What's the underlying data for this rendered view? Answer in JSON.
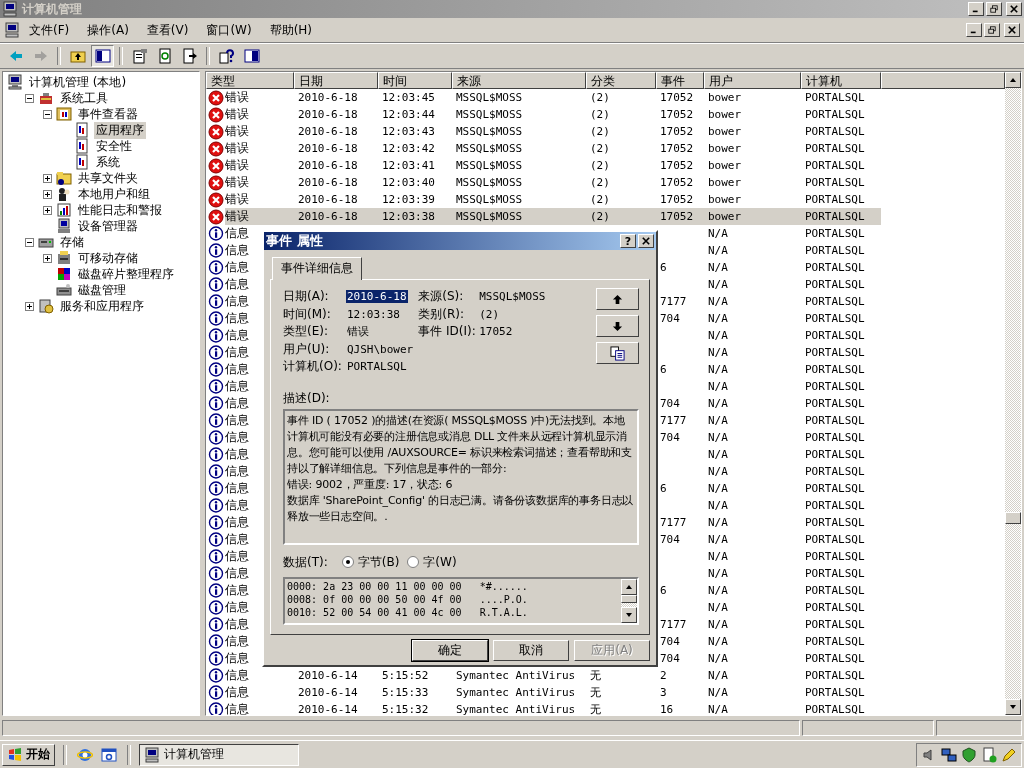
{
  "window": {
    "title": "计算机管理"
  },
  "menu": [
    "文件(F)",
    "操作(A)",
    "查看(V)",
    "窗口(W)",
    "帮助(H)"
  ],
  "toolbar": [
    {
      "disabled": false,
      "pressed": false
    },
    {
      "disabled": true,
      "pressed": false
    },
    {
      "disabled": false,
      "pressed": false
    },
    {
      "disabled": false,
      "pressed": true
    },
    {
      "disabled": false,
      "pressed": false
    },
    {
      "disabled": false,
      "pressed": false
    },
    {
      "disabled": false,
      "pressed": false
    },
    {
      "disabled": false,
      "pressed": false
    },
    {
      "disabled": false,
      "pressed": false
    }
  ],
  "tree": [
    {
      "label": "计算机管理 (本地)",
      "selected": false,
      "children": [
        {
          "label": "系统工具",
          "selected": false,
          "expanded": true,
          "children": [
            {
              "label": "事件查看器",
              "selected": false,
              "expanded": true,
              "children": [
                {
                  "label": "应用程序",
                  "selected": true
                },
                {
                  "label": "安全性",
                  "selected": false
                },
                {
                  "label": "系统",
                  "selected": false
                }
              ]
            },
            {
              "label": "共享文件夹",
              "selected": false,
              "expanded": false
            },
            {
              "label": "本地用户和组",
              "selected": false,
              "expanded": false
            },
            {
              "label": "性能日志和警报",
              "selected": false,
              "expanded": false
            },
            {
              "label": "设备管理器",
              "selected": false
            }
          ]
        },
        {
          "label": "存储",
          "selected": false,
          "expanded": true,
          "children": [
            {
              "label": "可移动存储",
              "selected": false,
              "expanded": false
            },
            {
              "label": "磁盘碎片整理程序",
              "selected": false
            },
            {
              "label": "磁盘管理",
              "selected": false
            }
          ]
        },
        {
          "label": "服务和应用程序",
          "selected": false,
          "expanded": false
        }
      ]
    }
  ],
  "table": {
    "columns": [
      "类型",
      "日期",
      "时间",
      "来源",
      "分类",
      "事件",
      "用户",
      "计算机"
    ],
    "rows": [
      {
        "kind": "error",
        "type": "错误",
        "date": "2010-6-18",
        "time": "12:03:45",
        "source": "MSSQL$MOSS",
        "category": "(2)",
        "event": "17052",
        "user": "bower",
        "computer": "PORTALSQL",
        "selected": false
      },
      {
        "kind": "error",
        "type": "错误",
        "date": "2010-6-18",
        "time": "12:03:44",
        "source": "MSSQL$MOSS",
        "category": "(2)",
        "event": "17052",
        "user": "bower",
        "computer": "PORTALSQL",
        "selected": false
      },
      {
        "kind": "error",
        "type": "错误",
        "date": "2010-6-18",
        "time": "12:03:43",
        "source": "MSSQL$MOSS",
        "category": "(2)",
        "event": "17052",
        "user": "bower",
        "computer": "PORTALSQL",
        "selected": false
      },
      {
        "kind": "error",
        "type": "错误",
        "date": "2010-6-18",
        "time": "12:03:42",
        "source": "MSSQL$MOSS",
        "category": "(2)",
        "event": "17052",
        "user": "bower",
        "computer": "PORTALSQL",
        "selected": false
      },
      {
        "kind": "error",
        "type": "错误",
        "date": "2010-6-18",
        "time": "12:03:41",
        "source": "MSSQL$MOSS",
        "category": "(2)",
        "event": "17052",
        "user": "bower",
        "computer": "PORTALSQL",
        "selected": false
      },
      {
        "kind": "error",
        "type": "错误",
        "date": "2010-6-18",
        "time": "12:03:40",
        "source": "MSSQL$MOSS",
        "category": "(2)",
        "event": "17052",
        "user": "bower",
        "computer": "PORTALSQL",
        "selected": false
      },
      {
        "kind": "error",
        "type": "错误",
        "date": "2010-6-18",
        "time": "12:03:39",
        "source": "MSSQL$MOSS",
        "category": "(2)",
        "event": "17052",
        "user": "bower",
        "computer": "PORTALSQL",
        "selected": false
      },
      {
        "kind": "error",
        "type": "错误",
        "date": "2010-6-18",
        "time": "12:03:38",
        "source": "MSSQL$MOSS",
        "category": "(2)",
        "event": "17052",
        "user": "bower",
        "computer": "PORTALSQL",
        "selected": true
      },
      {
        "kind": "info",
        "type": "信息",
        "user": "N/A",
        "computer": "PORTALSQL",
        "selected": false
      },
      {
        "kind": "info",
        "type": "信息",
        "user": "N/A",
        "computer": "PORTALSQL",
        "selected": false
      },
      {
        "kind": "info",
        "type": "信息",
        "event": "6",
        "user": "N/A",
        "computer": "PORTALSQL",
        "selected": false
      },
      {
        "kind": "info",
        "type": "信息",
        "user": "N/A",
        "computer": "PORTALSQL",
        "selected": false
      },
      {
        "kind": "info",
        "type": "信息",
        "event": "7177",
        "user": "N/A",
        "computer": "PORTALSQL",
        "selected": false
      },
      {
        "kind": "info",
        "type": "信息",
        "event": "704",
        "user": "N/A",
        "computer": "PORTALSQL",
        "selected": false
      },
      {
        "kind": "info",
        "type": "信息",
        "user": "N/A",
        "computer": "PORTALSQL",
        "selected": false
      },
      {
        "kind": "info",
        "type": "信息",
        "user": "N/A",
        "computer": "PORTALSQL",
        "selected": false
      },
      {
        "kind": "info",
        "type": "信息",
        "event": "6",
        "user": "N/A",
        "computer": "PORTALSQL",
        "selected": false
      },
      {
        "kind": "info",
        "type": "信息",
        "user": "N/A",
        "computer": "PORTALSQL",
        "selected": false
      },
      {
        "kind": "info",
        "type": "信息",
        "event": "704",
        "user": "N/A",
        "computer": "PORTALSQL",
        "selected": false
      },
      {
        "kind": "info",
        "type": "信息",
        "event": "7177",
        "user": "N/A",
        "computer": "PORTALSQL",
        "selected": false
      },
      {
        "kind": "info",
        "type": "信息",
        "event": "704",
        "user": "N/A",
        "computer": "PORTALSQL",
        "selected": false
      },
      {
        "kind": "info",
        "type": "信息",
        "user": "N/A",
        "computer": "PORTALSQL",
        "selected": false
      },
      {
        "kind": "info",
        "type": "信息",
        "user": "N/A",
        "computer": "PORTALSQL",
        "selected": false
      },
      {
        "kind": "info",
        "type": "信息",
        "event": "6",
        "user": "N/A",
        "computer": "PORTALSQL",
        "selected": false
      },
      {
        "kind": "info",
        "type": "信息",
        "user": "N/A",
        "computer": "PORTALSQL",
        "selected": false
      },
      {
        "kind": "info",
        "type": "信息",
        "event": "7177",
        "user": "N/A",
        "computer": "PORTALSQL",
        "selected": false
      },
      {
        "kind": "info",
        "type": "信息",
        "event": "704",
        "user": "N/A",
        "computer": "PORTALSQL",
        "selected": false
      },
      {
        "kind": "info",
        "type": "信息",
        "user": "N/A",
        "computer": "PORTALSQL",
        "selected": false
      },
      {
        "kind": "info",
        "type": "信息",
        "user": "N/A",
        "computer": "PORTALSQL",
        "selected": false
      },
      {
        "kind": "info",
        "type": "信息",
        "event": "6",
        "user": "N/A",
        "computer": "PORTALSQL",
        "selected": false
      },
      {
        "kind": "info",
        "type": "信息",
        "user": "N/A",
        "computer": "PORTALSQL",
        "selected": false
      },
      {
        "kind": "info",
        "type": "信息",
        "event": "7177",
        "user": "N/A",
        "computer": "PORTALSQL",
        "selected": false
      },
      {
        "kind": "info",
        "type": "信息",
        "event": "704",
        "user": "N/A",
        "computer": "PORTALSQL",
        "selected": false
      },
      {
        "kind": "info",
        "type": "信息",
        "event": "704",
        "user": "N/A",
        "computer": "PORTALSQL",
        "selected": false
      },
      {
        "kind": "info",
        "type": "信息",
        "date": "2010-6-14",
        "time": "5:15:52",
        "source": "Symantec AntiVirus",
        "category": "无",
        "event": "2",
        "user": "N/A",
        "computer": "PORTALSQL",
        "selected": false
      },
      {
        "kind": "info",
        "type": "信息",
        "date": "2010-6-14",
        "time": "5:15:33",
        "source": "Symantec AntiVirus",
        "category": "无",
        "event": "3",
        "user": "N/A",
        "computer": "PORTALSQL",
        "selected": false
      },
      {
        "kind": "info",
        "type": "信息",
        "date": "2010-6-14",
        "time": "5:15:32",
        "source": "Symantec AntiVirus",
        "category": "无",
        "event": "16",
        "user": "N/A",
        "computer": "PORTALSQL",
        "selected": false
      }
    ]
  },
  "dialog": {
    "title": "事件 属性",
    "help": "?",
    "tabs": [
      {
        "label": "事件详细信息",
        "selected": true
      }
    ],
    "left_fields": [
      {
        "label": "日期(A):",
        "value": "2010-6-18",
        "highlighted": true
      },
      {
        "label": "时间(M):",
        "value": "12:03:38",
        "highlighted": false
      },
      {
        "label": "类型(E):",
        "value": "错误",
        "highlighted": false
      },
      {
        "label": "用户(U):",
        "value": "QJSH\\bower",
        "highlighted": false
      },
      {
        "label": "计算机(O):",
        "value": "PORTALSQL",
        "highlighted": false
      }
    ],
    "right_fields": [
      {
        "label": "来源(S):",
        "value": "MSSQL$MOSS"
      },
      {
        "label": "类别(R):",
        "value": "(2)"
      },
      {
        "label": "事件 ID(I):",
        "value": "17052"
      }
    ],
    "description_label": "描述(D):",
    "description": "事件 ID ( 17052 )的描述(在资源( MSSQL$MOSS )中)无法找到。本地计算机可能没有必要的注册信息或消息 DLL 文件来从远程计算机显示消息。您可能可以使用 /AUXSOURCE= 标识来检索词描述；查看帮助和支持以了解详细信息。下列信息是事件的一部分:\n错误: 9002，严重度: 17，状态: 6\n数据库 'SharePoint_Config' 的日志已满。请备份该数据库的事务日志以释放一些日志空间。.",
    "data_label": "数据(T):",
    "data_formats": [
      {
        "label": "字节(B)",
        "selected": true
      },
      {
        "label": "字(W)",
        "selected": false
      }
    ],
    "data_lines": [
      "0000: 2a 23 00 00 11 00 00 00   *#......",
      "0008: 0f 00 00 00 50 00 4f 00   ....P.O.",
      "0010: 52 00 54 00 41 00 4c 00   R.T.A.L."
    ],
    "buttons": [
      {
        "label": "确定",
        "default": true,
        "disabled": false
      },
      {
        "label": "取消",
        "default": false,
        "disabled": false
      },
      {
        "label": "应用(A)",
        "default": false,
        "disabled": true
      }
    ]
  },
  "taskbar": {
    "start": "开始",
    "tasks": [
      {
        "label": "计算机管理",
        "selected": true
      }
    ]
  }
}
